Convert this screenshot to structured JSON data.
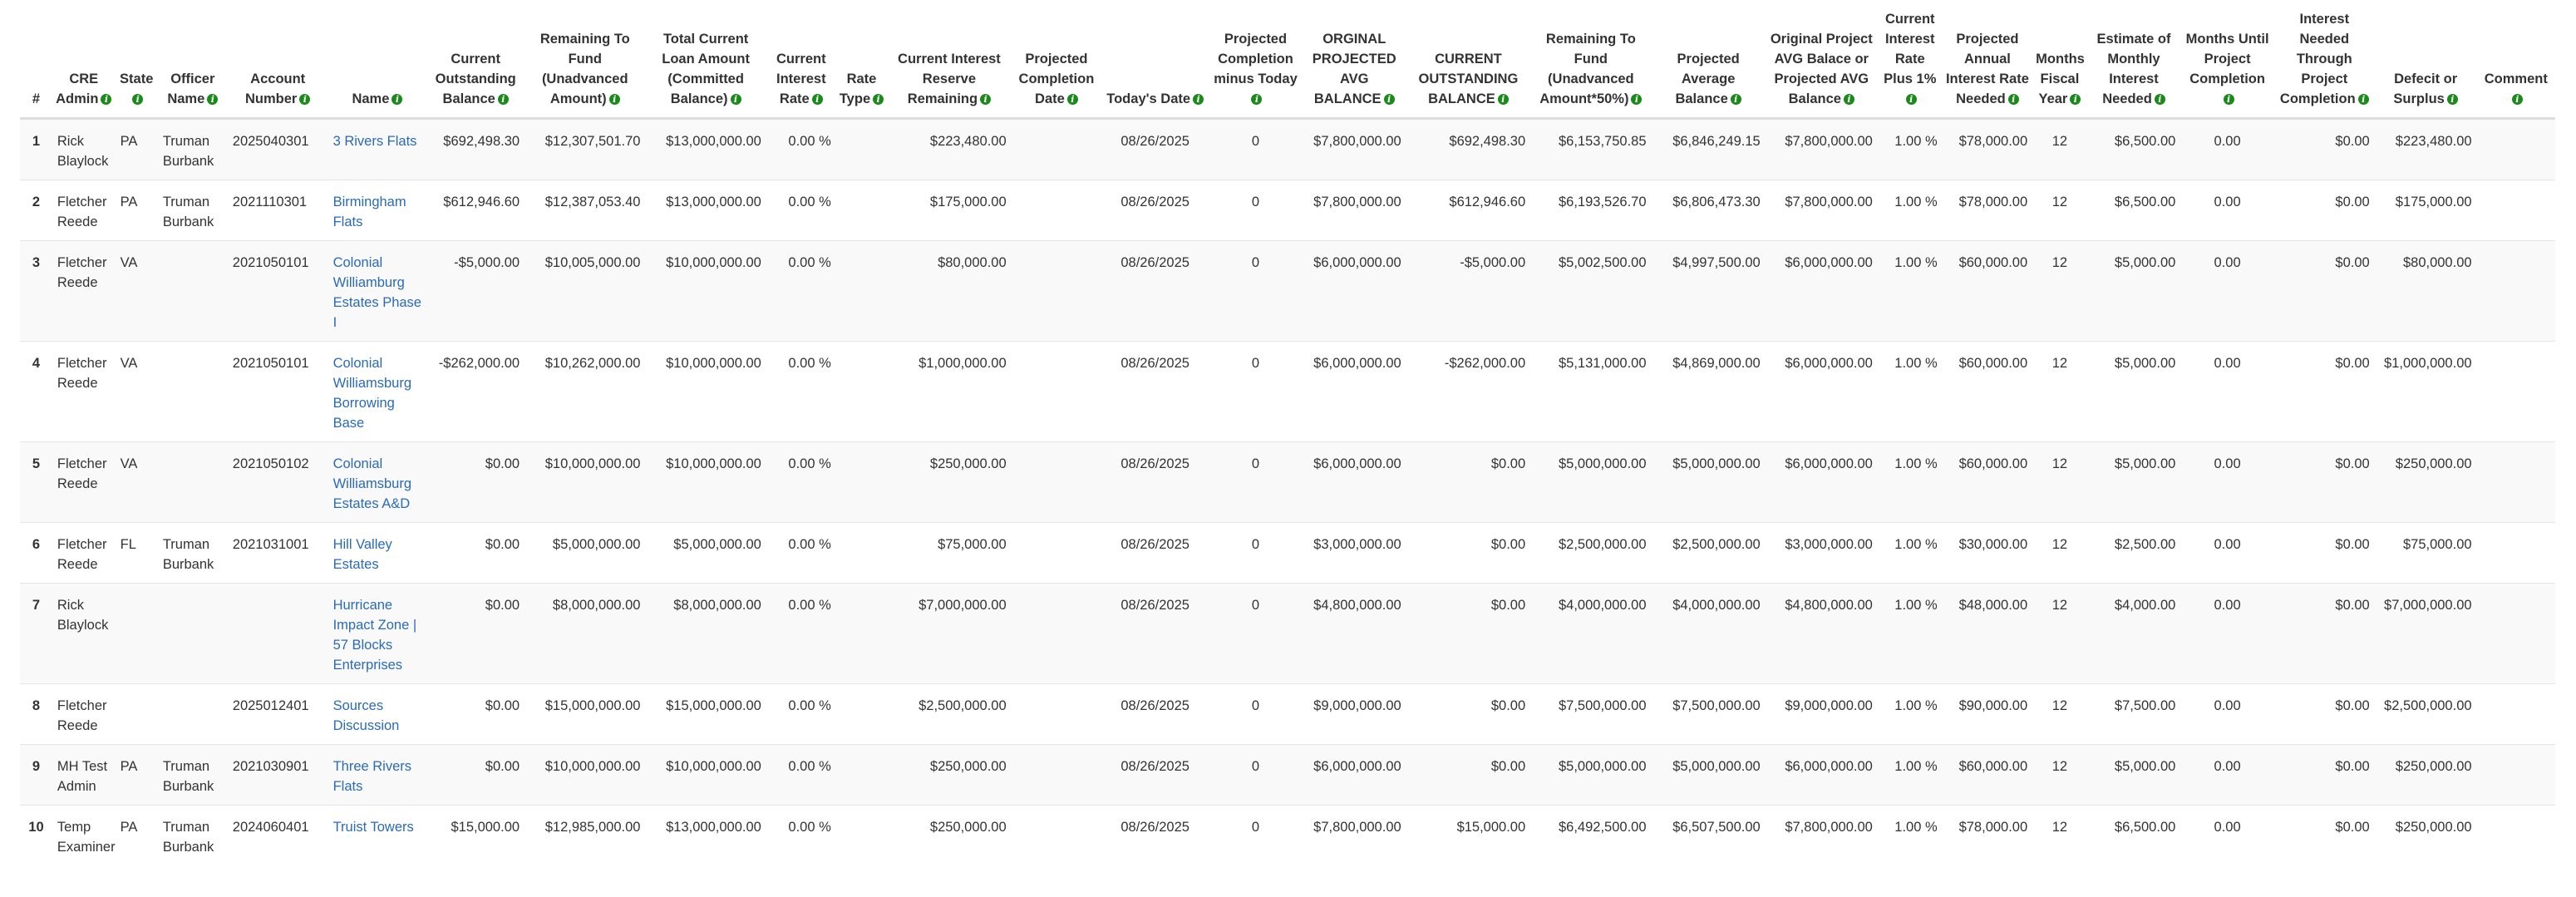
{
  "columns": [
    {
      "label": "#",
      "info": false
    },
    {
      "label": "CRE Admin",
      "info": true
    },
    {
      "label": "State",
      "info": true
    },
    {
      "label": "Officer Name",
      "info": true
    },
    {
      "label": "Account Number",
      "info": true
    },
    {
      "label": "Name",
      "info": true
    },
    {
      "label": "Current Outstanding Balance",
      "info": true
    },
    {
      "label": "Remaining To Fund (Unadvanced Amount)",
      "info": true
    },
    {
      "label": "Total Current Loan Amount (Committed Balance)",
      "info": true
    },
    {
      "label": "Current Interest Rate",
      "info": true
    },
    {
      "label": "Rate Type",
      "info": true
    },
    {
      "label": "Current Interest Reserve Remaining",
      "info": true
    },
    {
      "label": "Projected Completion Date",
      "info": true
    },
    {
      "label": "Today's Date",
      "info": true
    },
    {
      "label": "Projected Completion minus Today",
      "info": true
    },
    {
      "label": "ORGINAL PROJECTED AVG BALANCE",
      "info": true
    },
    {
      "label": "CURRENT OUTSTANDING BALANCE",
      "info": true
    },
    {
      "label": "Remaining To Fund (Unadvanced Amount*50%)",
      "info": true
    },
    {
      "label": "Projected Average Balance",
      "info": true
    },
    {
      "label": "Original Project AVG Balace or Projected AVG Balance",
      "info": true
    },
    {
      "label": "Current Interest Rate Plus 1%",
      "info": true
    },
    {
      "label": "Projected Annual Interest Rate Needed",
      "info": true
    },
    {
      "label": "Months Fiscal Year",
      "info": true
    },
    {
      "label": "Estimate of Monthly Interest Needed",
      "info": true
    },
    {
      "label": "Months Until Project Completion",
      "info": true
    },
    {
      "label": "Interest Needed Through Project Completion",
      "info": true
    },
    {
      "label": "Defecit or Surplus",
      "info": true
    },
    {
      "label": "Comment",
      "info": true
    }
  ],
  "rows": [
    {
      "idx": "1",
      "admin": "Rick Blaylock",
      "state": "PA",
      "officer": "Truman Burbank",
      "account": "2025040301",
      "name": "3 Rivers Flats",
      "cob": "$692,498.30",
      "rtf": "$12,307,501.70",
      "tcl": "$13,000,000.00",
      "rate": "0.00 %",
      "rtype": "",
      "reserve": "$223,480.00",
      "pcd": "",
      "today": "08/26/2025",
      "pcmt": "0",
      "opab": "$7,800,000.00",
      "cob2": "$692,498.30",
      "rtf50": "$6,153,750.85",
      "pab": "$6,846,249.15",
      "oporpab": "$7,800,000.00",
      "rate1": "1.00 %",
      "pair": "$78,000.00",
      "mfy": "12",
      "emin": "$6,500.00",
      "mupc": "0.00",
      "intpc": "$0.00",
      "def": "$223,480.00",
      "comment": ""
    },
    {
      "idx": "2",
      "admin": "Fletcher Reede",
      "state": "PA",
      "officer": "Truman Burbank",
      "account": "2021110301",
      "name": "Birmingham Flats",
      "cob": "$612,946.60",
      "rtf": "$12,387,053.40",
      "tcl": "$13,000,000.00",
      "rate": "0.00 %",
      "rtype": "",
      "reserve": "$175,000.00",
      "pcd": "",
      "today": "08/26/2025",
      "pcmt": "0",
      "opab": "$7,800,000.00",
      "cob2": "$612,946.60",
      "rtf50": "$6,193,526.70",
      "pab": "$6,806,473.30",
      "oporpab": "$7,800,000.00",
      "rate1": "1.00 %",
      "pair": "$78,000.00",
      "mfy": "12",
      "emin": "$6,500.00",
      "mupc": "0.00",
      "intpc": "$0.00",
      "def": "$175,000.00",
      "comment": ""
    },
    {
      "idx": "3",
      "admin": "Fletcher Reede",
      "state": "VA",
      "officer": "",
      "account": "2021050101",
      "name": "Colonial Williamburg Estates Phase I",
      "cob": "-$5,000.00",
      "rtf": "$10,005,000.00",
      "tcl": "$10,000,000.00",
      "rate": "0.00 %",
      "rtype": "",
      "reserve": "$80,000.00",
      "pcd": "",
      "today": "08/26/2025",
      "pcmt": "0",
      "opab": "$6,000,000.00",
      "cob2": "-$5,000.00",
      "rtf50": "$5,002,500.00",
      "pab": "$4,997,500.00",
      "oporpab": "$6,000,000.00",
      "rate1": "1.00 %",
      "pair": "$60,000.00",
      "mfy": "12",
      "emin": "$5,000.00",
      "mupc": "0.00",
      "intpc": "$0.00",
      "def": "$80,000.00",
      "comment": ""
    },
    {
      "idx": "4",
      "admin": "Fletcher Reede",
      "state": "VA",
      "officer": "",
      "account": "2021050101",
      "name": "Colonial Williamsburg Borrowing Base",
      "cob": "-$262,000.00",
      "rtf": "$10,262,000.00",
      "tcl": "$10,000,000.00",
      "rate": "0.00 %",
      "rtype": "",
      "reserve": "$1,000,000.00",
      "pcd": "",
      "today": "08/26/2025",
      "pcmt": "0",
      "opab": "$6,000,000.00",
      "cob2": "-$262,000.00",
      "rtf50": "$5,131,000.00",
      "pab": "$4,869,000.00",
      "oporpab": "$6,000,000.00",
      "rate1": "1.00 %",
      "pair": "$60,000.00",
      "mfy": "12",
      "emin": "$5,000.00",
      "mupc": "0.00",
      "intpc": "$0.00",
      "def": "$1,000,000.00",
      "comment": ""
    },
    {
      "idx": "5",
      "admin": "Fletcher Reede",
      "state": "VA",
      "officer": "",
      "account": "2021050102",
      "name": "Colonial Williamsburg Estates A&D",
      "cob": "$0.00",
      "rtf": "$10,000,000.00",
      "tcl": "$10,000,000.00",
      "rate": "0.00 %",
      "rtype": "",
      "reserve": "$250,000.00",
      "pcd": "",
      "today": "08/26/2025",
      "pcmt": "0",
      "opab": "$6,000,000.00",
      "cob2": "$0.00",
      "rtf50": "$5,000,000.00",
      "pab": "$5,000,000.00",
      "oporpab": "$6,000,000.00",
      "rate1": "1.00 %",
      "pair": "$60,000.00",
      "mfy": "12",
      "emin": "$5,000.00",
      "mupc": "0.00",
      "intpc": "$0.00",
      "def": "$250,000.00",
      "comment": ""
    },
    {
      "idx": "6",
      "admin": "Fletcher Reede",
      "state": "FL",
      "officer": "Truman Burbank",
      "account": "2021031001",
      "name": "Hill Valley Estates",
      "cob": "$0.00",
      "rtf": "$5,000,000.00",
      "tcl": "$5,000,000.00",
      "rate": "0.00 %",
      "rtype": "",
      "reserve": "$75,000.00",
      "pcd": "",
      "today": "08/26/2025",
      "pcmt": "0",
      "opab": "$3,000,000.00",
      "cob2": "$0.00",
      "rtf50": "$2,500,000.00",
      "pab": "$2,500,000.00",
      "oporpab": "$3,000,000.00",
      "rate1": "1.00 %",
      "pair": "$30,000.00",
      "mfy": "12",
      "emin": "$2,500.00",
      "mupc": "0.00",
      "intpc": "$0.00",
      "def": "$75,000.00",
      "comment": ""
    },
    {
      "idx": "7",
      "admin": "Rick Blaylock",
      "state": "",
      "officer": "",
      "account": "",
      "name": "Hurricane Impact Zone | 57 Blocks Enterprises",
      "cob": "$0.00",
      "rtf": "$8,000,000.00",
      "tcl": "$8,000,000.00",
      "rate": "0.00 %",
      "rtype": "",
      "reserve": "$7,000,000.00",
      "pcd": "",
      "today": "08/26/2025",
      "pcmt": "0",
      "opab": "$4,800,000.00",
      "cob2": "$0.00",
      "rtf50": "$4,000,000.00",
      "pab": "$4,000,000.00",
      "oporpab": "$4,800,000.00",
      "rate1": "1.00 %",
      "pair": "$48,000.00",
      "mfy": "12",
      "emin": "$4,000.00",
      "mupc": "0.00",
      "intpc": "$0.00",
      "def": "$7,000,000.00",
      "comment": ""
    },
    {
      "idx": "8",
      "admin": "Fletcher Reede",
      "state": "",
      "officer": "",
      "account": "2025012401",
      "name": "Sources Discussion",
      "cob": "$0.00",
      "rtf": "$15,000,000.00",
      "tcl": "$15,000,000.00",
      "rate": "0.00 %",
      "rtype": "",
      "reserve": "$2,500,000.00",
      "pcd": "",
      "today": "08/26/2025",
      "pcmt": "0",
      "opab": "$9,000,000.00",
      "cob2": "$0.00",
      "rtf50": "$7,500,000.00",
      "pab": "$7,500,000.00",
      "oporpab": "$9,000,000.00",
      "rate1": "1.00 %",
      "pair": "$90,000.00",
      "mfy": "12",
      "emin": "$7,500.00",
      "mupc": "0.00",
      "intpc": "$0.00",
      "def": "$2,500,000.00",
      "comment": ""
    },
    {
      "idx": "9",
      "admin": "MH Test Admin",
      "state": "PA",
      "officer": "Truman Burbank",
      "account": "2021030901",
      "name": "Three Rivers Flats",
      "cob": "$0.00",
      "rtf": "$10,000,000.00",
      "tcl": "$10,000,000.00",
      "rate": "0.00 %",
      "rtype": "",
      "reserve": "$250,000.00",
      "pcd": "",
      "today": "08/26/2025",
      "pcmt": "0",
      "opab": "$6,000,000.00",
      "cob2": "$0.00",
      "rtf50": "$5,000,000.00",
      "pab": "$5,000,000.00",
      "oporpab": "$6,000,000.00",
      "rate1": "1.00 %",
      "pair": "$60,000.00",
      "mfy": "12",
      "emin": "$5,000.00",
      "mupc": "0.00",
      "intpc": "$0.00",
      "def": "$250,000.00",
      "comment": ""
    },
    {
      "idx": "10",
      "admin": "Temp Examiner",
      "state": "PA",
      "officer": "Truman Burbank",
      "account": "2024060401",
      "name": "Truist Towers",
      "cob": "$15,000.00",
      "rtf": "$12,985,000.00",
      "tcl": "$13,000,000.00",
      "rate": "0.00 %",
      "rtype": "",
      "reserve": "$250,000.00",
      "pcd": "",
      "today": "08/26/2025",
      "pcmt": "0",
      "opab": "$7,800,000.00",
      "cob2": "$15,000.00",
      "rtf50": "$6,492,500.00",
      "pab": "$6,507,500.00",
      "oporpab": "$7,800,000.00",
      "rate1": "1.00 %",
      "pair": "$78,000.00",
      "mfy": "12",
      "emin": "$6,500.00",
      "mupc": "0.00",
      "intpc": "$0.00",
      "def": "$250,000.00",
      "comment": ""
    }
  ],
  "info_icon": "info-icon",
  "colors": {
    "link": "#2a6ab7",
    "info": "#1a8a1a",
    "stripe": "#f9f9f9"
  }
}
